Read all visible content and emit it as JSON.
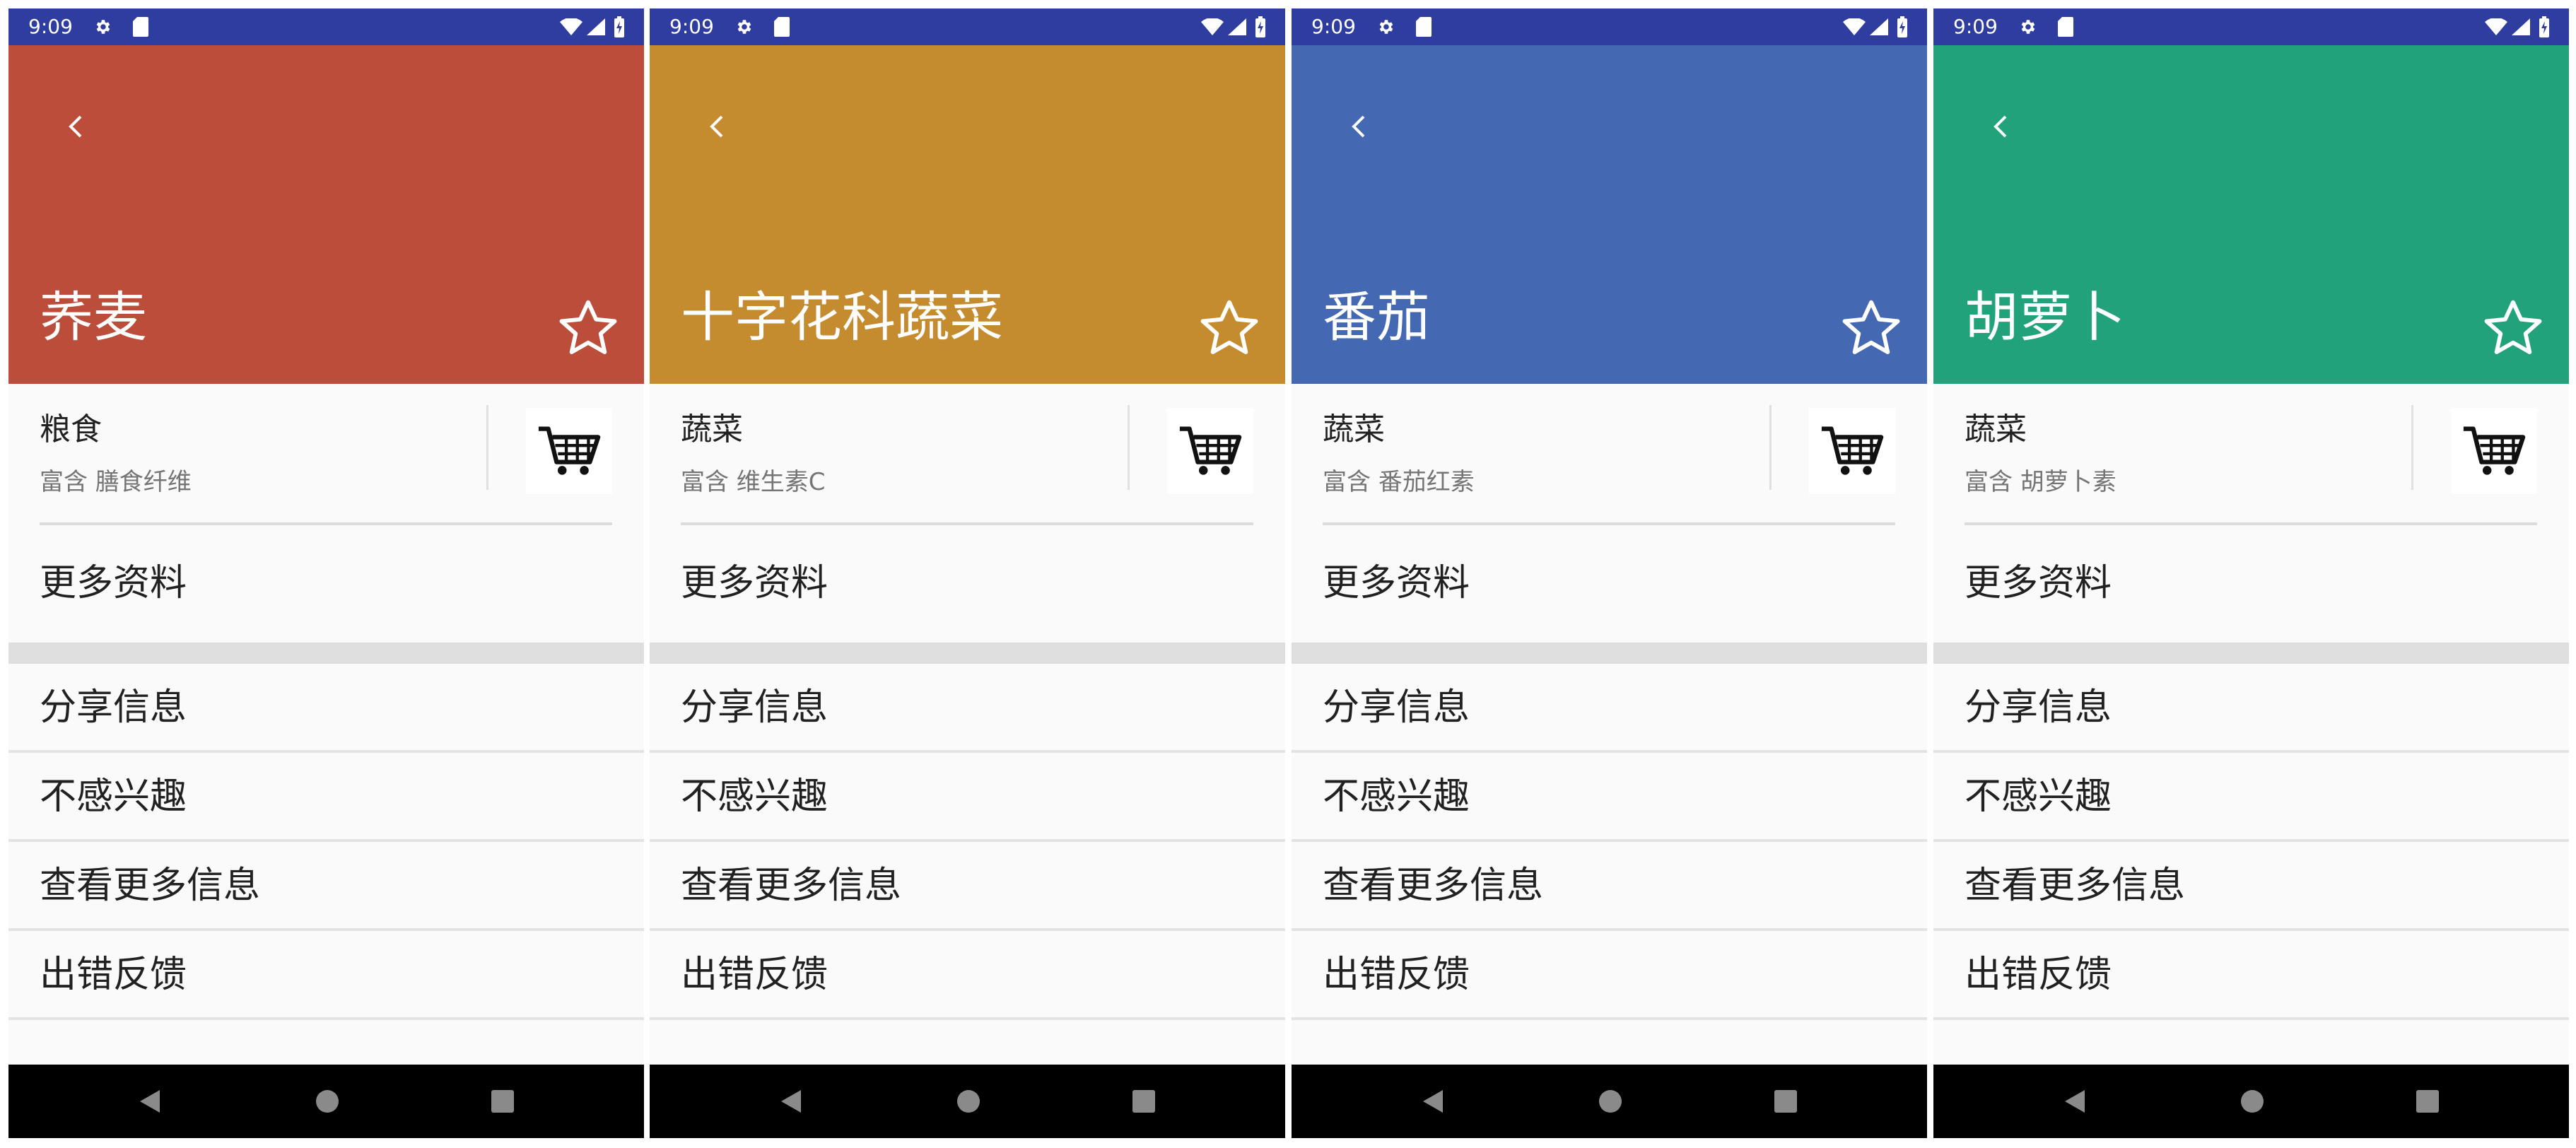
{
  "status_bar": {
    "time": "9:09",
    "background_color": "#2e3d9f",
    "icons": [
      "gear-icon",
      "sim-card-icon",
      "wifi-icon",
      "signal-icon",
      "battery-icon"
    ]
  },
  "icons": {
    "back": "back-arrow-icon",
    "favorite": "star-outline-icon",
    "cart": "shopping-cart-icon",
    "nav_back": "nav-back-icon",
    "nav_home": "nav-home-icon",
    "nav_recents": "nav-recents-icon"
  },
  "screens": [
    {
      "title": "荞麦",
      "header_color": "#bc4d3b",
      "category": "粮食",
      "rich_in": "富含 膳食纤维",
      "more_info_label": "更多资料",
      "menu": [
        "分享信息",
        "不感兴趣",
        "查看更多信息",
        "出错反馈"
      ]
    },
    {
      "title": "十字花科蔬菜",
      "header_color": "#c48b2f",
      "category": "蔬菜",
      "rich_in": "富含 维生素C",
      "more_info_label": "更多资料",
      "menu": [
        "分享信息",
        "不感兴趣",
        "查看更多信息",
        "出错反馈"
      ]
    },
    {
      "title": "番茄",
      "header_color": "#4468b1",
      "category": "蔬菜",
      "rich_in": "富含 番茄红素",
      "more_info_label": "更多资料",
      "menu": [
        "分享信息",
        "不感兴趣",
        "查看更多信息",
        "出错反馈"
      ]
    },
    {
      "title": "胡萝卜",
      "header_color": "#22a27a",
      "category": "蔬菜",
      "rich_in": "富含 胡萝卜素",
      "more_info_label": "更多资料",
      "menu": [
        "分享信息",
        "不感兴趣",
        "查看更多信息",
        "出错反馈"
      ]
    }
  ]
}
